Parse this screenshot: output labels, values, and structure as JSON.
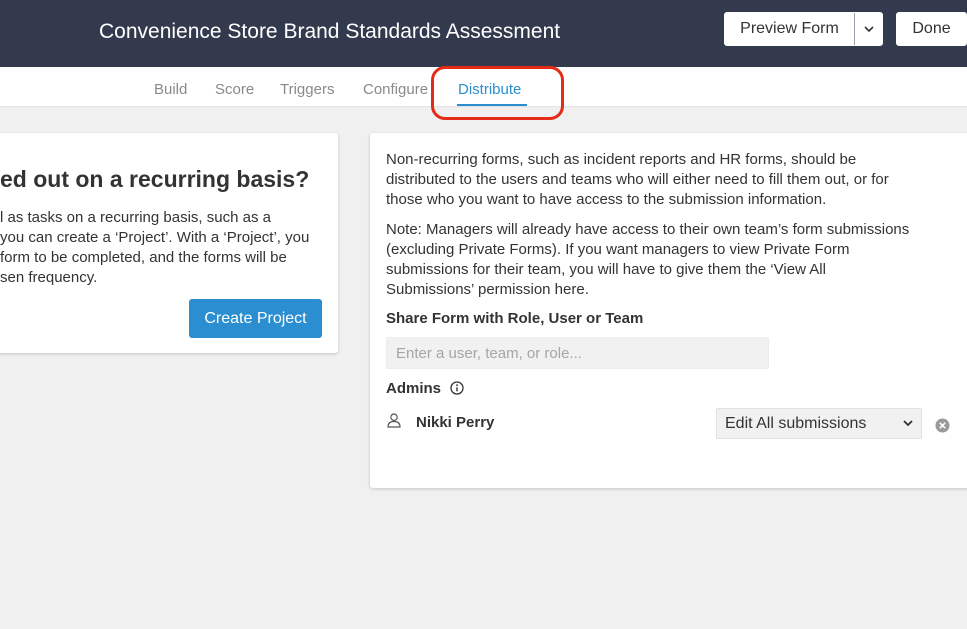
{
  "header": {
    "form_title": "Convenience Store Brand Standards Assessment",
    "preview_label": "Preview Form",
    "preview_menu_icon": "chevron-down-icon",
    "done_label": "Done"
  },
  "tabs": [
    {
      "label": "Build",
      "active": false
    },
    {
      "label": "Score",
      "active": false
    },
    {
      "label": "Triggers",
      "active": false
    },
    {
      "label": "Configure",
      "active": false
    },
    {
      "label": "Distribute",
      "active": true
    }
  ],
  "left_card": {
    "heading": "ed out on a recurring basis?",
    "body_lines": [
      "l as tasks on a recurring basis, such as a",
      "you can create a ‘Project’. With a ‘Project’, you",
      "form to be completed, and the forms will be",
      "sen frequency."
    ],
    "create_button": "Create Project"
  },
  "distribute": {
    "intro_lines": [
      "Non-recurring forms, such as incident reports and HR forms, should be",
      "distributed to the users and teams who will either need to fill them out, or for",
      "those who you want to have access to the submission information."
    ],
    "note_lines": [
      "Note: Managers will already have access to their own team’s form submissions",
      "(excluding Private Forms). If you want managers to view Private Form",
      "submissions for their team, you will have to give them the ‘View All",
      "Submissions’ permission here."
    ],
    "share_label": "Share Form with Role, User or Team",
    "search_placeholder": "Enter a user, team, or role...",
    "admins_label": "Admins",
    "admins_info_icon": "info-icon",
    "admins": [
      {
        "icon": "user-icon",
        "name": "Nikki Perry",
        "permission": "Edit All submissions",
        "remove_icon": "remove-circle-icon"
      }
    ]
  },
  "colors": {
    "header_bg": "#333a4d",
    "accent_blue": "#2b8ed0",
    "highlight_red": "#e52a15",
    "page_bg": "#f0f0f0"
  }
}
